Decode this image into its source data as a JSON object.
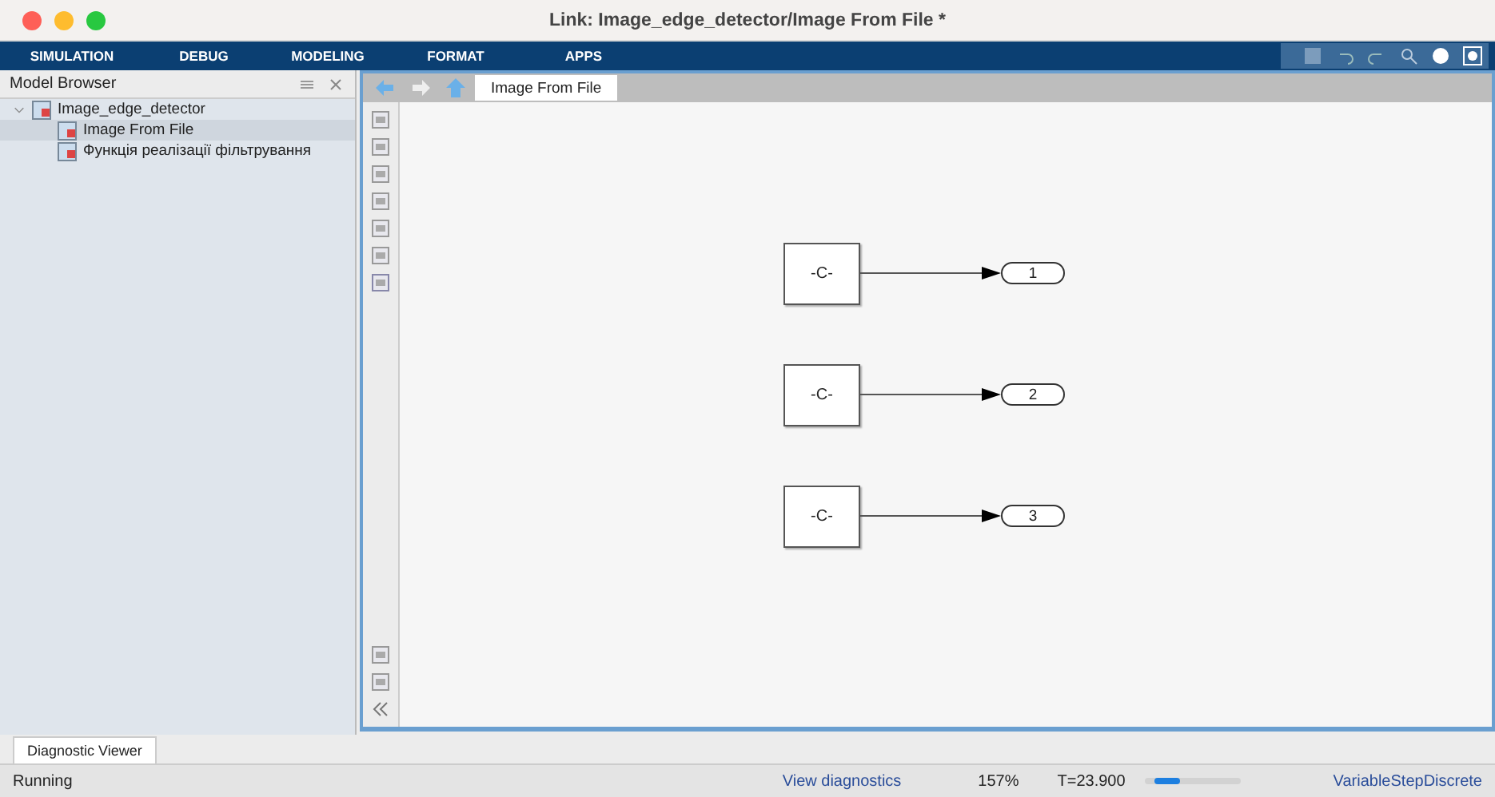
{
  "window": {
    "title": "Link: Image_edge_detector/Image From File *"
  },
  "menu": [
    {
      "label": "SIMULATION"
    },
    {
      "label": "DEBUG"
    },
    {
      "label": "MODELING"
    },
    {
      "label": "FORMAT"
    },
    {
      "label": "APPS"
    }
  ],
  "model_browser": {
    "title": "Model Browser",
    "tree": [
      {
        "label": "Image_edge_detector",
        "expanded": true,
        "selected": false,
        "children": [
          {
            "label": "Image From File",
            "selected": true
          },
          {
            "label": "Функція реалізації фільтрування",
            "selected": false
          }
        ]
      }
    ]
  },
  "editor": {
    "tabs": [
      {
        "label": "Image From File",
        "selected": true
      }
    ],
    "blocks": [
      {
        "label": "-C-",
        "port": "1"
      },
      {
        "label": "-C-",
        "port": "2"
      },
      {
        "label": "-C-",
        "port": "3"
      }
    ]
  },
  "bottom_tabs": [
    {
      "label": "Diagnostic Viewer",
      "selected": true
    }
  ],
  "status_bar": {
    "state": "Running",
    "link": "View diagnostics",
    "zoom": "157%",
    "time": "T=23.900",
    "progress": {
      "level": 0.3
    },
    "solver": "VariableStepDiscrete"
  }
}
